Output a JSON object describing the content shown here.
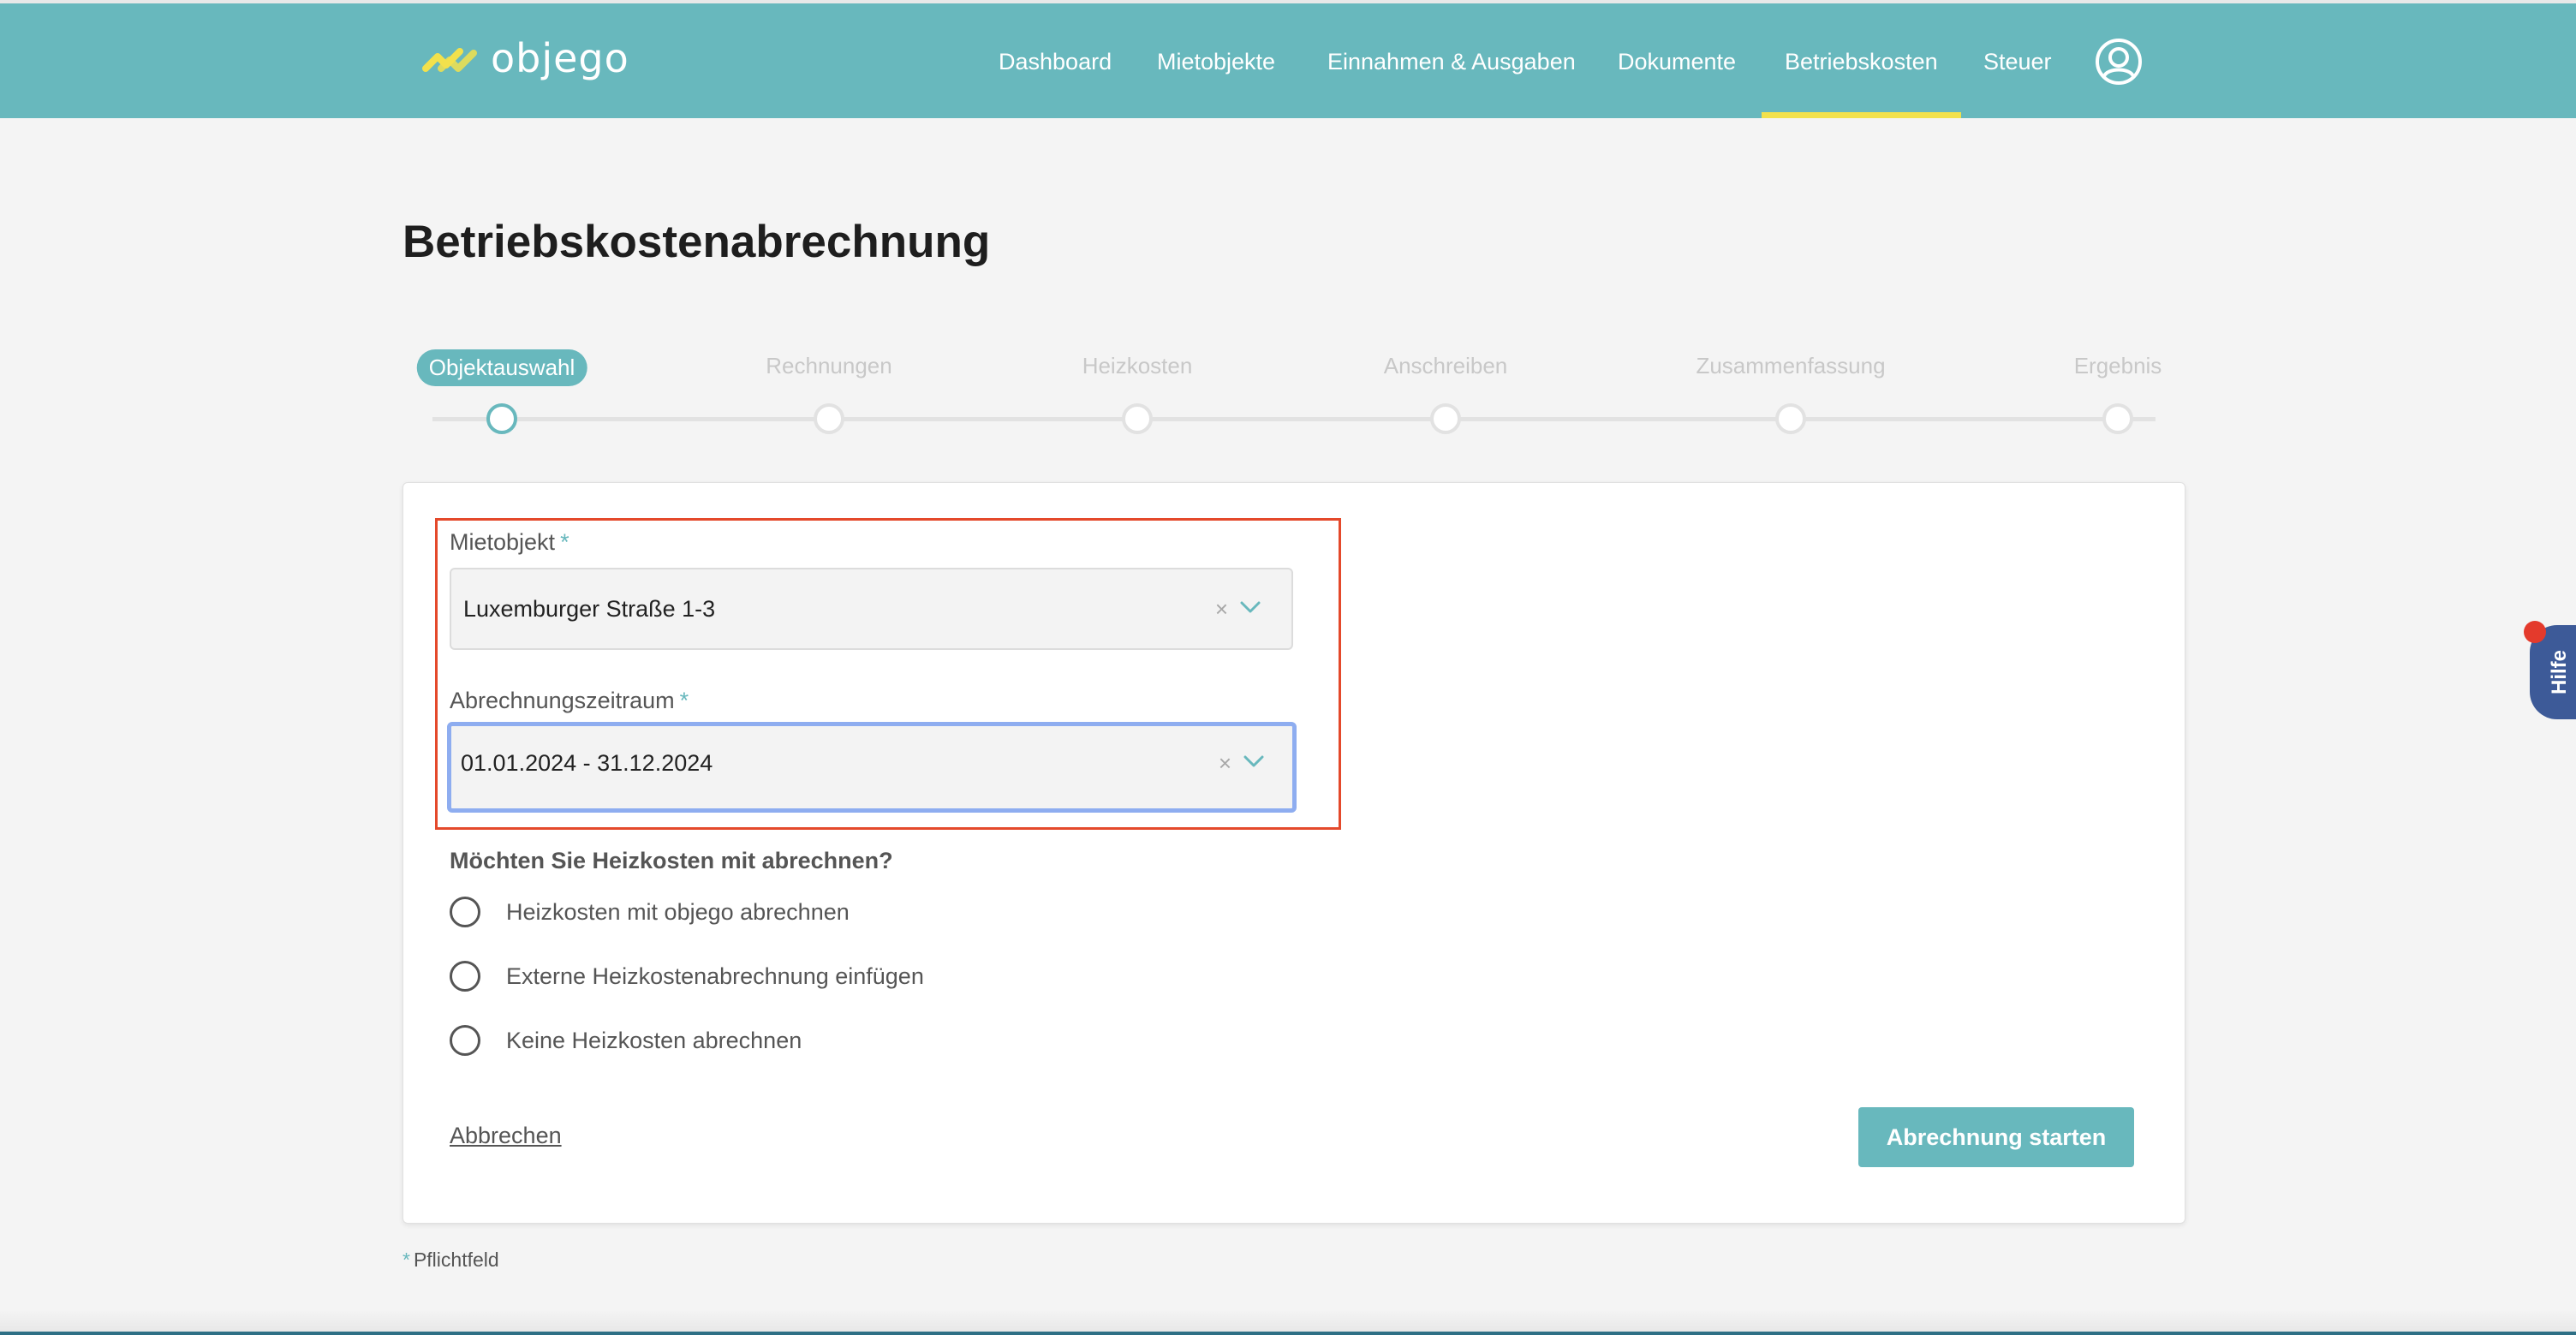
{
  "header": {
    "brand": "objego",
    "nav": [
      {
        "label": "Dashboard",
        "active": false
      },
      {
        "label": "Mietobjekte",
        "active": false
      },
      {
        "label": "Einnahmen & Ausgaben",
        "active": false
      },
      {
        "label": "Dokumente",
        "active": false
      },
      {
        "label": "Betriebskosten",
        "active": true
      },
      {
        "label": "Steuer",
        "active": false
      }
    ],
    "user_icon": "user-circle-icon"
  },
  "page": {
    "title": "Betriebskostenabrechnung"
  },
  "stepper": {
    "steps": [
      {
        "label": "Objektauswahl",
        "active": true
      },
      {
        "label": "Rechnungen",
        "active": false
      },
      {
        "label": "Heizkosten",
        "active": false
      },
      {
        "label": "Anschreiben",
        "active": false
      },
      {
        "label": "Zusammenfassung",
        "active": false
      },
      {
        "label": "Ergebnis",
        "active": false
      }
    ]
  },
  "form": {
    "property": {
      "label": "Mietobjekt",
      "required_mark": "*",
      "value": "Luxemburger Straße 1-3",
      "clear_glyph": "×"
    },
    "period": {
      "label": "Abrechnungszeitraum",
      "required_mark": "*",
      "value": "01.01.2024 - 31.12.2024",
      "clear_glyph": "×",
      "focused": true
    },
    "heating_question": "Möchten Sie Heizkosten mit abrechnen?",
    "heating_options": [
      {
        "label": "Heizkosten mit objego abrechnen",
        "selected": false
      },
      {
        "label": "Externe Heizkostenabrechnung einfügen",
        "selected": false
      },
      {
        "label": "Keine Heizkosten abrechnen",
        "selected": false
      }
    ],
    "cancel_label": "Abbrechen",
    "submit_label": "Abrechnung starten"
  },
  "footnote": {
    "star": "*",
    "text": "Pflichtfeld"
  },
  "help": {
    "label": "Hilfe"
  },
  "colors": {
    "brand_teal": "#68b8bd",
    "active_underline": "#f2e14c",
    "help_blue": "#3d5a98",
    "notification_red": "#e43a2c",
    "highlight_red": "#e4492b",
    "focus_blue": "#8eadf0"
  }
}
